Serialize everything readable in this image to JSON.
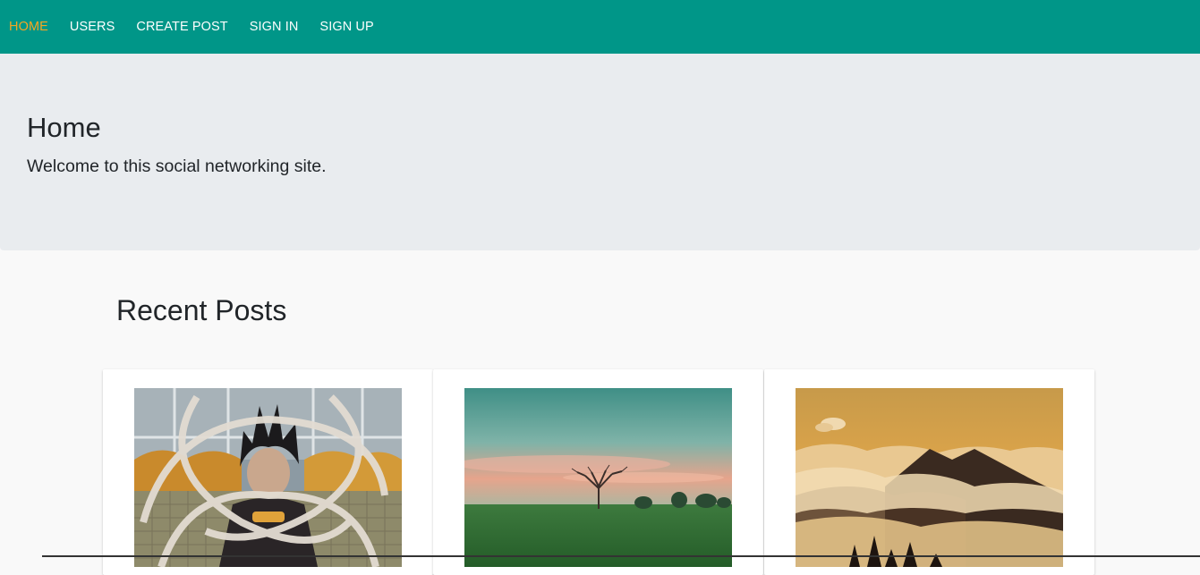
{
  "nav": {
    "items": [
      {
        "label": "HOME",
        "active": true
      },
      {
        "label": "USERS",
        "active": false
      },
      {
        "label": "CREATE POST",
        "active": false
      },
      {
        "label": "SIGN IN",
        "active": false
      },
      {
        "label": "SIGN UP",
        "active": false
      }
    ]
  },
  "hero": {
    "title": "Home",
    "subtitle": "Welcome to this social networking site."
  },
  "recent": {
    "title": "Recent Posts",
    "posts": [
      {
        "image": "anime-character-image"
      },
      {
        "image": "sunset-tree-field-image"
      },
      {
        "image": "mountains-above-clouds-image"
      }
    ]
  },
  "colors": {
    "navbar": "#009688",
    "active_nav": "#f5a623",
    "hero_bg": "#e9ecef",
    "page_bg": "#f9f9f9"
  }
}
